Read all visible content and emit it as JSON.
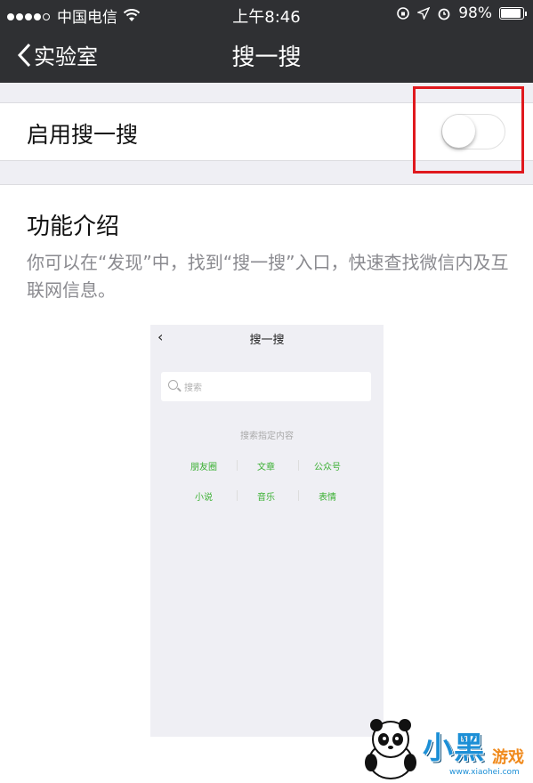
{
  "status_bar": {
    "carrier": "中国电信",
    "time": "上午8:46",
    "battery": "98%"
  },
  "nav": {
    "back_label": "实验室",
    "title": "搜一搜"
  },
  "setting": {
    "label": "启用搜一搜",
    "enabled": false
  },
  "intro": {
    "heading": "功能介绍",
    "description": "你可以在“发现”中，找到“搜一搜”入口，快速查找微信内及互联网信息。"
  },
  "preview": {
    "title": "搜一搜",
    "search_placeholder": "搜索",
    "hint": "搜索指定内容",
    "categories": [
      "朋友圈",
      "文章",
      "公众号",
      "小说",
      "音乐",
      "表情"
    ]
  },
  "watermark": {
    "brand": "小黑",
    "brand_suffix": "游戏",
    "url": "www.xiaohei.com"
  },
  "colors": {
    "nav_bg": "#2f3033",
    "highlight_box": "#e0191e",
    "category_green": "#3bb033"
  }
}
